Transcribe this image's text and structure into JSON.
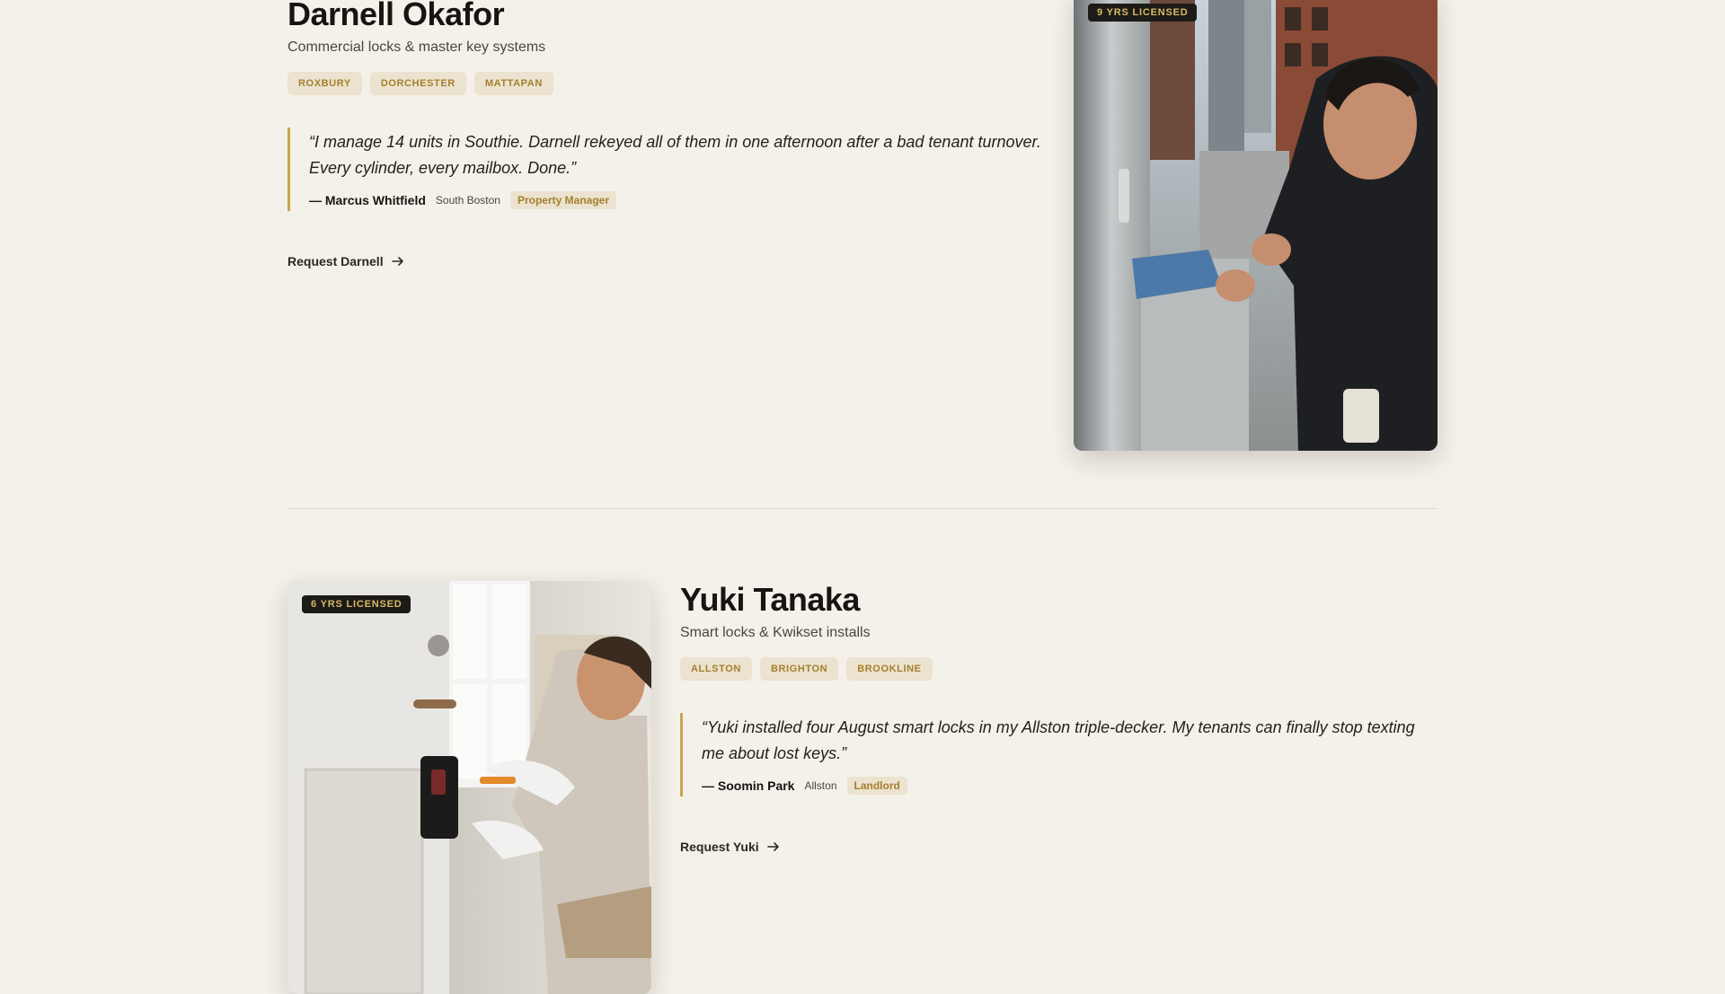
{
  "profiles": [
    {
      "name": "Darnell Okafor",
      "specialty": "Commercial locks & master key systems",
      "tags": [
        "ROXBURY",
        "DORCHESTER",
        "MATTAPAN"
      ],
      "quote": "“I manage 14 units in Southie. Darnell rekeyed all of them in one afternoon after a bad tenant turnover. Every cylinder, every mailbox. Done.”",
      "author": "— Marcus Whitfield",
      "location": "South Boston",
      "role": "Property Manager",
      "cta": "Request Darnell",
      "badge": "9 YRS LICENSED"
    },
    {
      "name": "Yuki Tanaka",
      "specialty": "Smart locks & Kwikset installs",
      "tags": [
        "ALLSTON",
        "BRIGHTON",
        "BROOKLINE"
      ],
      "quote": "“Yuki installed four August smart locks in my Allston triple-decker. My tenants can finally stop texting me about lost keys.”",
      "author": "— Soomin Park",
      "location": "Allston",
      "role": "Landlord",
      "cta": "Request Yuki",
      "badge": "6 YRS LICENSED"
    }
  ],
  "icons": {
    "cta": "arrow-right-icon"
  },
  "colors": {
    "background": "#f4f1ea",
    "accent": "#c7a74d",
    "tag_bg": "#ebe3cf",
    "tag_text": "#a57f2c",
    "badge_bg": "#1d1b17"
  }
}
